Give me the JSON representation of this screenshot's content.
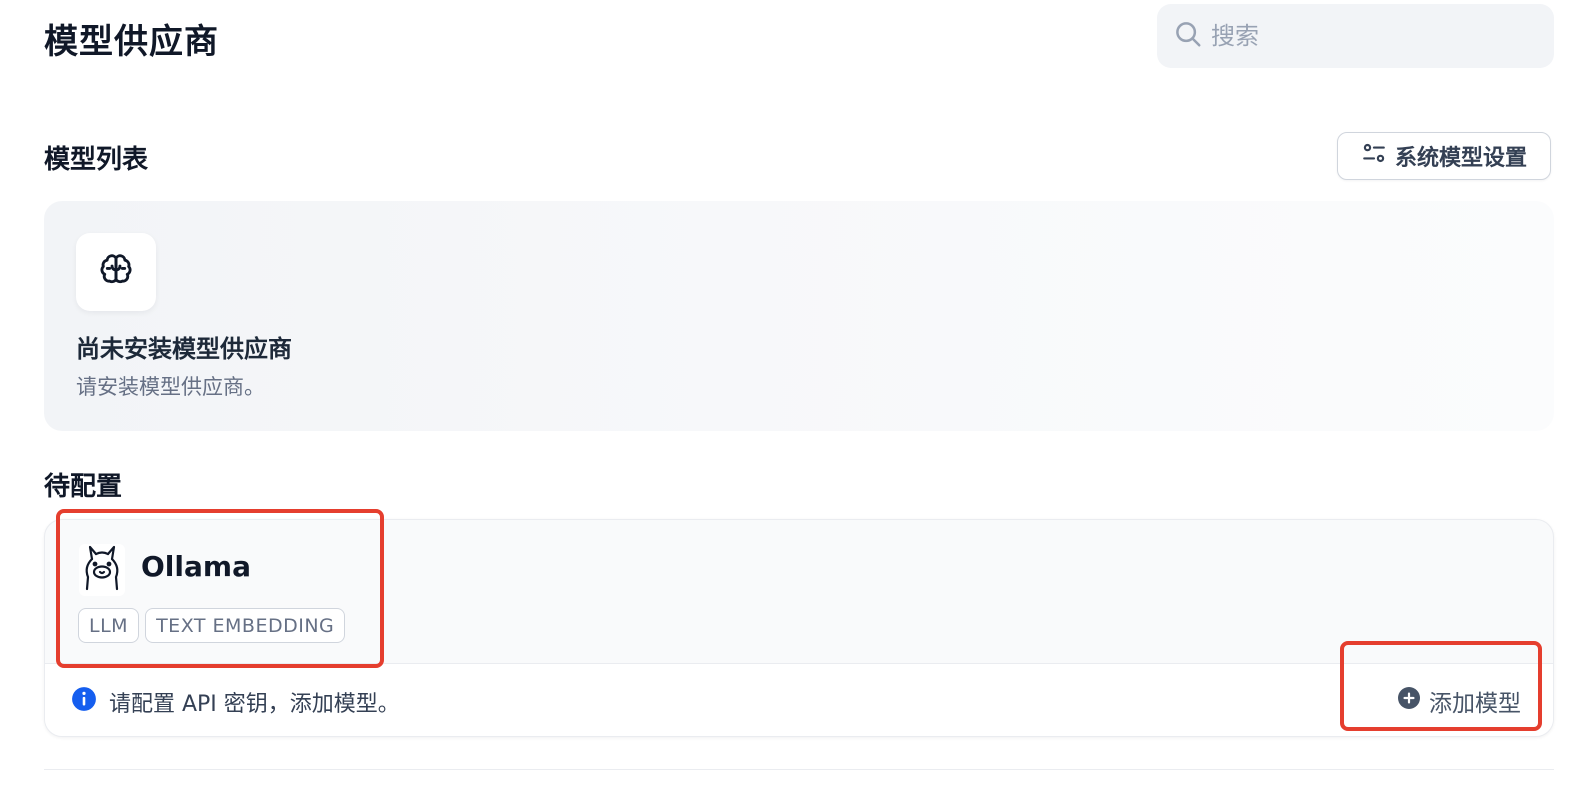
{
  "header": {
    "title": "模型供应商",
    "search_placeholder": "搜索"
  },
  "model_list": {
    "title": "模型列表",
    "system_settings_label": "系统模型设置",
    "empty_state": {
      "icon": "brain-icon",
      "title": "尚未安装模型供应商",
      "description": "请安装模型供应商。"
    }
  },
  "pending": {
    "title": "待配置",
    "providers": [
      {
        "name": "Ollama",
        "icon": "llama-icon",
        "tags": [
          "LLM",
          "TEXT EMBEDDING"
        ],
        "info_text": "请配置 API 密钥，添加模型。",
        "add_model_label": "添加模型"
      }
    ]
  },
  "colors": {
    "highlight": "#e53e2e",
    "info_blue": "#155eef",
    "text_primary": "#101828",
    "text_secondary": "#667085"
  }
}
